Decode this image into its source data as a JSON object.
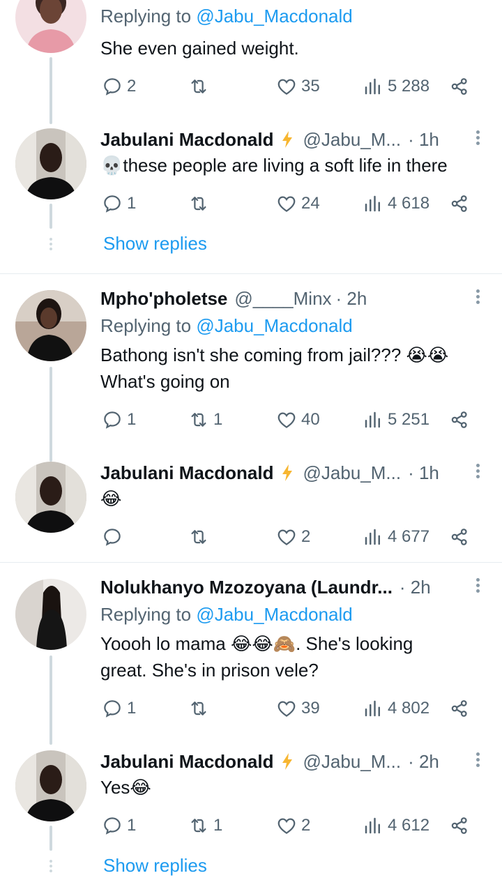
{
  "colors": {
    "accent": "#1d9bf0",
    "secondary_text": "#536471",
    "bolt": "#f7b631"
  },
  "reply_prefix": "Replying to ",
  "tweets": [
    {
      "replying_to": "@Jabu_Macdonald",
      "text": "She even gained weight.",
      "replies": "2",
      "retweets": "",
      "likes": "35",
      "views": "5 288"
    },
    {
      "name": "Jabulani Macdonald",
      "handle": "@Jabu_M...",
      "time": "· 1h",
      "text": "💀these people are living a soft life in there",
      "replies": "1",
      "retweets": "",
      "likes": "24",
      "views": "4 618",
      "show_replies": "Show replies"
    },
    {
      "name": "Mpho'pholetse",
      "handle": "@____Minx",
      "time": "· 2h",
      "replying_to": "@Jabu_Macdonald",
      "text_lines": [
        "Bathong isn't she coming from jail??? 😭😭",
        "What's going on"
      ],
      "replies": "1",
      "retweets": "1",
      "likes": "40",
      "views": "5 251"
    },
    {
      "name": "Jabulani Macdonald",
      "handle": "@Jabu_M...",
      "time": "· 1h",
      "text": "😂",
      "replies": "",
      "retweets": "",
      "likes": "2",
      "views": "4 677"
    },
    {
      "name": "Nolukhanyo Mzozoyana (Laundr...",
      "handle": "",
      "time": "· 2h",
      "replying_to": "@Jabu_Macdonald",
      "text_lines": [
        "Yoooh lo mama 😂😂🙈. She's looking",
        "great. She's in prison vele?"
      ],
      "replies": "1",
      "retweets": "",
      "likes": "39",
      "views": "4 802"
    },
    {
      "name": "Jabulani Macdonald",
      "handle": "@Jabu_M...",
      "time": "· 2h",
      "text": "Yes😂",
      "replies": "1",
      "retweets": "1",
      "likes": "2",
      "views": "4 612",
      "show_replies": "Show replies"
    }
  ]
}
